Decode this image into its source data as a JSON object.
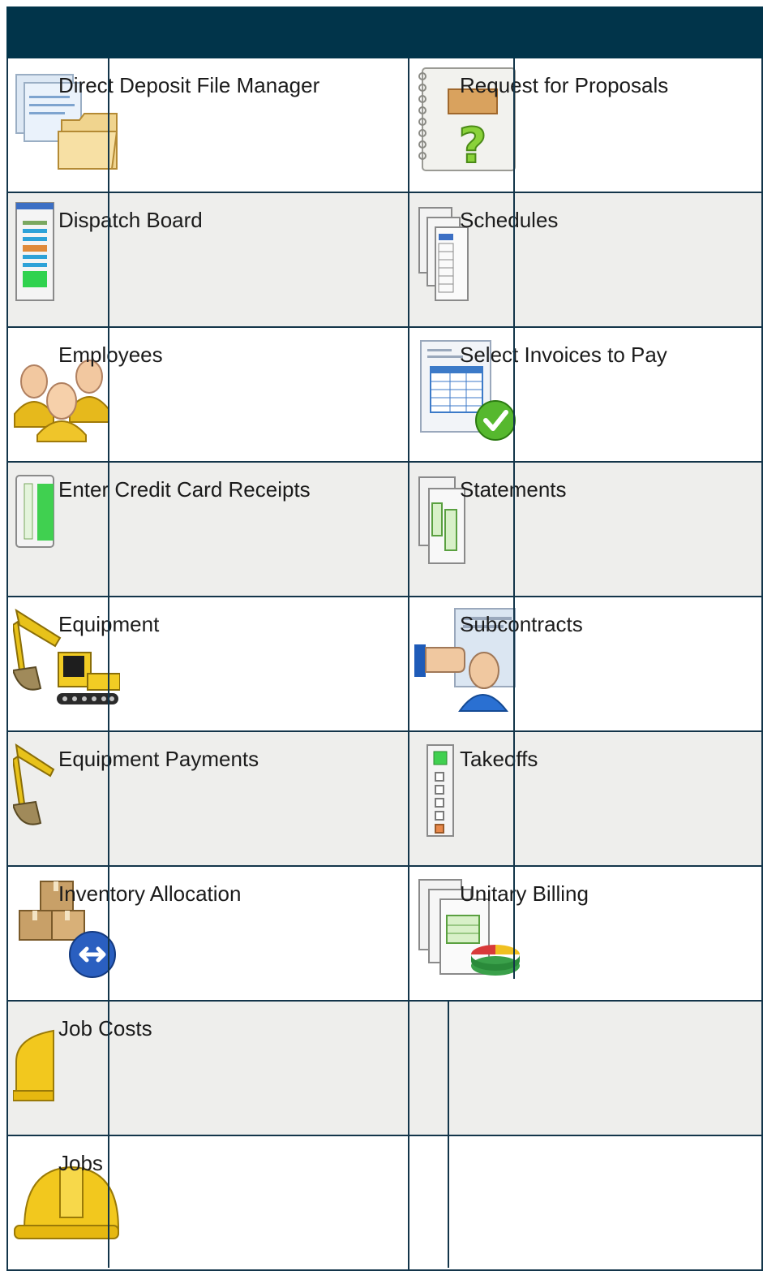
{
  "rows": [
    {
      "left": {
        "label": "Direct Deposit File Manager",
        "icon": "documents-folder-icon"
      },
      "right": {
        "label": "Request for Proposals",
        "icon": "notebook-question-icon"
      }
    },
    {
      "left": {
        "label": "Dispatch Board",
        "icon": "dispatch-board-icon"
      },
      "right": {
        "label": "Schedules",
        "icon": "schedules-icon"
      }
    },
    {
      "left": {
        "label": "Employees",
        "icon": "employees-icon"
      },
      "right": {
        "label": "Select Invoices to Pay",
        "icon": "invoice-check-icon"
      }
    },
    {
      "left": {
        "label": "Enter Credit Card Receipts",
        "icon": "receipt-icon"
      },
      "right": {
        "label": "Statements",
        "icon": "statements-icon"
      }
    },
    {
      "left": {
        "label": "Equipment",
        "icon": "excavator-icon"
      },
      "right": {
        "label": "Subcontracts",
        "icon": "subcontract-icon"
      }
    },
    {
      "left": {
        "label": "Equipment Payments",
        "icon": "excavator-arm-icon"
      },
      "right": {
        "label": "Takeoffs",
        "icon": "takeoffs-icon"
      }
    },
    {
      "left": {
        "label": "Inventory Allocation",
        "icon": "boxes-arrows-icon"
      },
      "right": {
        "label": "Unitary Billing",
        "icon": "billing-pie-icon"
      }
    },
    {
      "left": {
        "label": "Job Costs",
        "icon": "hardhat-partial-icon"
      },
      "right": {
        "label": "",
        "icon": ""
      }
    },
    {
      "left": {
        "label": "Jobs",
        "icon": "hardhat-icon"
      },
      "right": {
        "label": "",
        "icon": ""
      }
    }
  ]
}
